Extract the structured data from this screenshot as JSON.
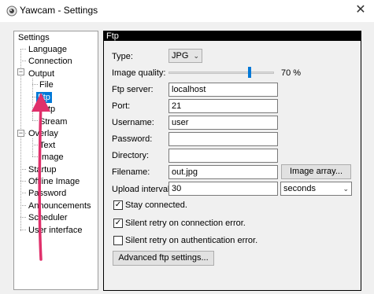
{
  "window": {
    "title": "Yawcam - Settings",
    "close_glyph": "✕"
  },
  "tree": {
    "items": [
      {
        "label": "Settings"
      },
      {
        "label": "Language"
      },
      {
        "label": "Connection"
      },
      {
        "label": "Output",
        "expander": "−"
      },
      {
        "label": "File"
      },
      {
        "label": "Ftp",
        "selected": true
      },
      {
        "label": "Http"
      },
      {
        "label": "Stream"
      },
      {
        "label": "Overlay",
        "expander": "−"
      },
      {
        "label": "Text"
      },
      {
        "label": "Image"
      },
      {
        "label": "Startup"
      },
      {
        "label": "Offline Image"
      },
      {
        "label": "Password"
      },
      {
        "label": "Announcements"
      },
      {
        "label": "Scheduler"
      },
      {
        "label": "User interface"
      }
    ]
  },
  "panel": {
    "header": "Ftp",
    "type": {
      "label": "Type:",
      "value": "JPG"
    },
    "image_quality": {
      "label": "Image quality:",
      "value_text": "70 %",
      "fraction": 0.7
    },
    "ftp_server": {
      "label": "Ftp server:",
      "value": "localhost"
    },
    "port": {
      "label": "Port:",
      "value": "21"
    },
    "username": {
      "label": "Username:",
      "value": "user"
    },
    "password": {
      "label": "Password:",
      "value": ""
    },
    "directory": {
      "label": "Directory:",
      "value": ""
    },
    "filename": {
      "label": "Filename:",
      "value": "out.jpg",
      "button": "Image array..."
    },
    "upload_interval": {
      "label": "Upload interval:",
      "value": "30",
      "unit": "seconds"
    },
    "stay_connected": {
      "label": "Stay connected.",
      "checked": true
    },
    "silent_retry_connection": {
      "label": "Silent retry on connection error.",
      "checked": true
    },
    "silent_retry_auth": {
      "label": "Silent retry on authentication error.",
      "checked": false
    },
    "advanced_button": "Advanced ftp settings..."
  },
  "colors": {
    "accent": "#0078d7",
    "annotation_arrow": "#e0306b"
  }
}
